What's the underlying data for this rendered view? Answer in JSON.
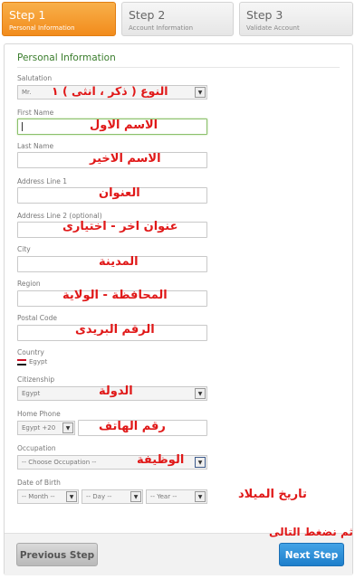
{
  "steps": [
    {
      "number": "Step 1",
      "label": "Personal Information",
      "active": true
    },
    {
      "number": "Step 2",
      "label": "Account Information",
      "active": false
    },
    {
      "number": "Step 3",
      "label": "Validate Account",
      "active": false
    }
  ],
  "form": {
    "section_title": "Personal Information",
    "salutation": {
      "label": "Salutation",
      "value": "Mr.",
      "note": "النوع ( ذكر ، انثى ) ١"
    },
    "first_name": {
      "label": "First Name",
      "value": "",
      "note": "الاسم الاول"
    },
    "last_name": {
      "label": "Last Name",
      "value": "",
      "note": "الاسم الاخير"
    },
    "address1": {
      "label": "Address Line 1",
      "value": "",
      "note": "العنوان"
    },
    "address2": {
      "label": "Address Line 2 (optional)",
      "value": "",
      "note": "عنوان اخر - اختيارى"
    },
    "city": {
      "label": "City",
      "value": "",
      "note": "المدينة"
    },
    "region": {
      "label": "Region",
      "value": "",
      "note": "المحافظة - الولاية"
    },
    "postal": {
      "label": "Postal Code",
      "value": "",
      "note": "الرقم البريدى"
    },
    "country": {
      "label": "Country",
      "value": "Egypt"
    },
    "citizenship": {
      "label": "Citizenship",
      "value": "Egypt",
      "note": "الدولة"
    },
    "phone": {
      "label": "Home Phone",
      "code": "Egypt +20",
      "value": "",
      "note": "رقم الهاتف"
    },
    "occupation": {
      "label": "Occupation",
      "value": "-- Choose Occupation --",
      "note": "الوظيفة"
    },
    "dob": {
      "label": "Date of Birth",
      "month": "-- Month --",
      "day": "-- Day --",
      "year": "-- Year --",
      "note": "تاريخ الميلاد"
    }
  },
  "footer": {
    "prev_label": "Previous Step",
    "next_label": "Next Step",
    "note": "ثم نضغط التالى"
  },
  "colors": {
    "accent_orange": "#f28c1c",
    "section_green": "#3a7d2c",
    "note_red": "#e01818",
    "next_blue": "#1e7fcb"
  }
}
